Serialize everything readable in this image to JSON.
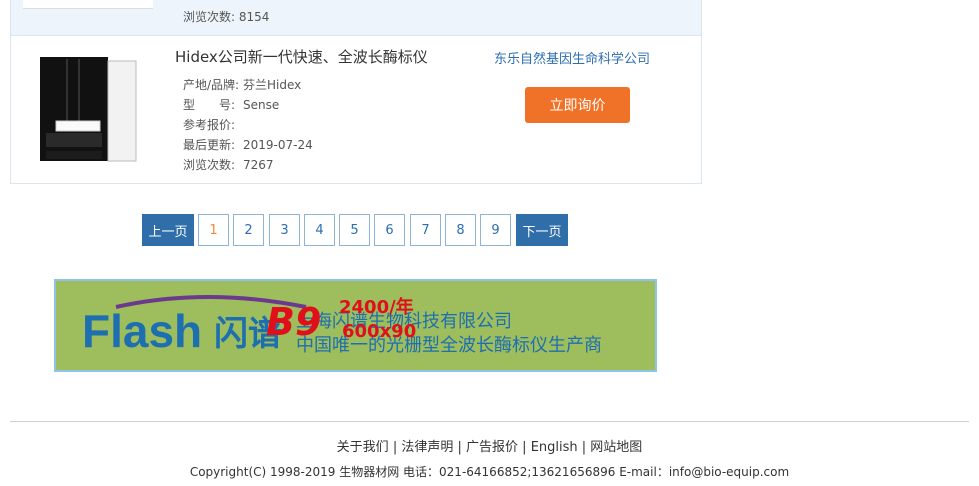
{
  "listing": {
    "prev_item": {
      "views_label": "浏览次数:",
      "views": "8154"
    },
    "item": {
      "title": "Hidex公司新一代快速、全波长酶标仪",
      "origin_label": "产地/品牌:",
      "origin": "芬兰Hidex",
      "model_label": "型　　号:",
      "model": "Sense",
      "price_label": "参考报价:",
      "price": "",
      "updated_label": "最后更新:",
      "updated": "2019-07-24",
      "views_label": "浏览次数:",
      "views": "7267",
      "company": "东乐自然基因生命科学公司",
      "inquire_label": "立即询价"
    }
  },
  "pagination": {
    "prev": "上一页",
    "pages": [
      "1",
      "2",
      "3",
      "4",
      "5",
      "6",
      "7",
      "8",
      "9"
    ],
    "current": "1",
    "next": "下一页"
  },
  "banner": {
    "brand": "Flash",
    "brand_cn": "闪谱",
    "company": "上海闪谱生物科技有限公司",
    "slogan": "中国唯一的光栅型全波长酶标仪生产商",
    "ad_slot": "B9",
    "ad_price": "2400/年",
    "ad_size": "600x90"
  },
  "footer": {
    "links": [
      "关于我们",
      "法律声明",
      "广告报价",
      "English",
      "网站地图"
    ],
    "copyright": "Copyright(C) 1998-2019 生物器材网 电话：021-64166852;13621656896 E-mail：info@bio-equip.com"
  },
  "colors": {
    "link_blue": "#2c6eb1",
    "accent_orange": "#f07228",
    "pager_nav": "#2f6ea8",
    "banner_green": "#9ebd5d"
  }
}
